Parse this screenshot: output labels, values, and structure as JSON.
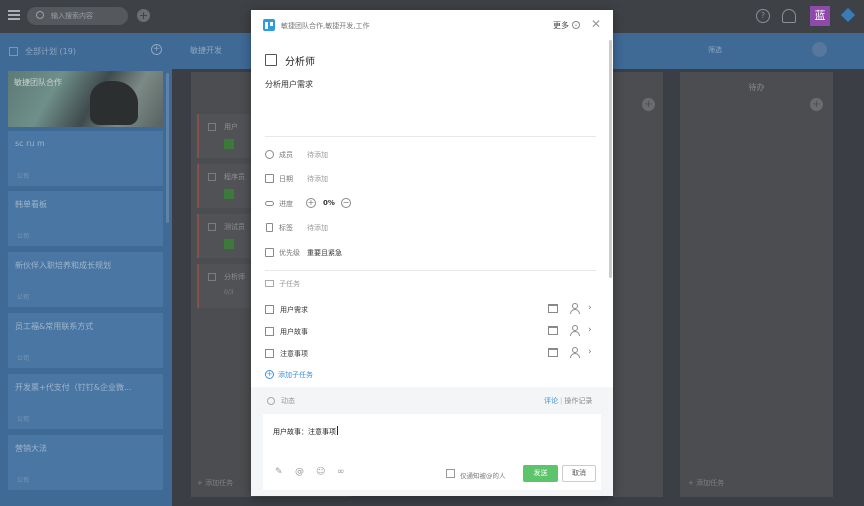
{
  "topbar": {
    "search_placeholder": "输入搜索内容",
    "avatar_text": "蓝"
  },
  "sidebar": {
    "title": "全部计划 (19)",
    "hero_project": "敏捷团队合作",
    "projects": [
      {
        "name": "sc ru m",
        "badge": "公司"
      },
      {
        "name": "韩单看板",
        "badge": "公司"
      },
      {
        "name": "新伙伴入职培养和成长规划",
        "badge": "公司"
      },
      {
        "name": "员工福&常用联系方式",
        "badge": "公司"
      },
      {
        "name": "开发票+代支付（钉钉&企业微...",
        "badge": "公司"
      },
      {
        "name": "营销大法",
        "badge": "公司"
      }
    ]
  },
  "board": {
    "name": "敏捷开发",
    "filter_label": "筛选",
    "columns": [
      {
        "title": "",
        "add_task": "添加任务"
      },
      {
        "title": "待办",
        "add_task": "添加任务"
      }
    ],
    "cards": [
      {
        "name": "用户"
      },
      {
        "name": "程序员"
      },
      {
        "name": "测试员"
      },
      {
        "name": "分析师",
        "progress": "0/3"
      }
    ]
  },
  "modal": {
    "breadcrumb": "敏捷团队合作,敏捷开发,工作",
    "more_label": "更多",
    "title": "分析师",
    "description": "分析用户需求",
    "props": {
      "member": {
        "label": "成员",
        "value": "待添加"
      },
      "date": {
        "label": "日期",
        "value": "待添加"
      },
      "progress": {
        "label": "进度",
        "value": "0%",
        "fraction": 0
      },
      "tag": {
        "label": "标签",
        "value": "待添加"
      },
      "priority": {
        "label": "优先级",
        "value": "重要且紧急"
      }
    },
    "subtasks_label": "子任务",
    "subtasks": [
      {
        "name": "用户需求"
      },
      {
        "name": "用户故事"
      },
      {
        "name": "注意事项"
      }
    ],
    "add_subtask": "添加子任务",
    "activity": {
      "label": "动态",
      "tab_comment": "评论",
      "tab_separator": "|",
      "tab_log": "操作记录"
    },
    "comment": {
      "text": "用户故事：注意事项",
      "notify_label": "仅通知被@的人",
      "send_label": "发送",
      "cancel_label": "取消"
    }
  },
  "colors": {
    "accent": "#3a8ee0",
    "send": "#5cc46a",
    "sidebar": "#3f6a96"
  }
}
